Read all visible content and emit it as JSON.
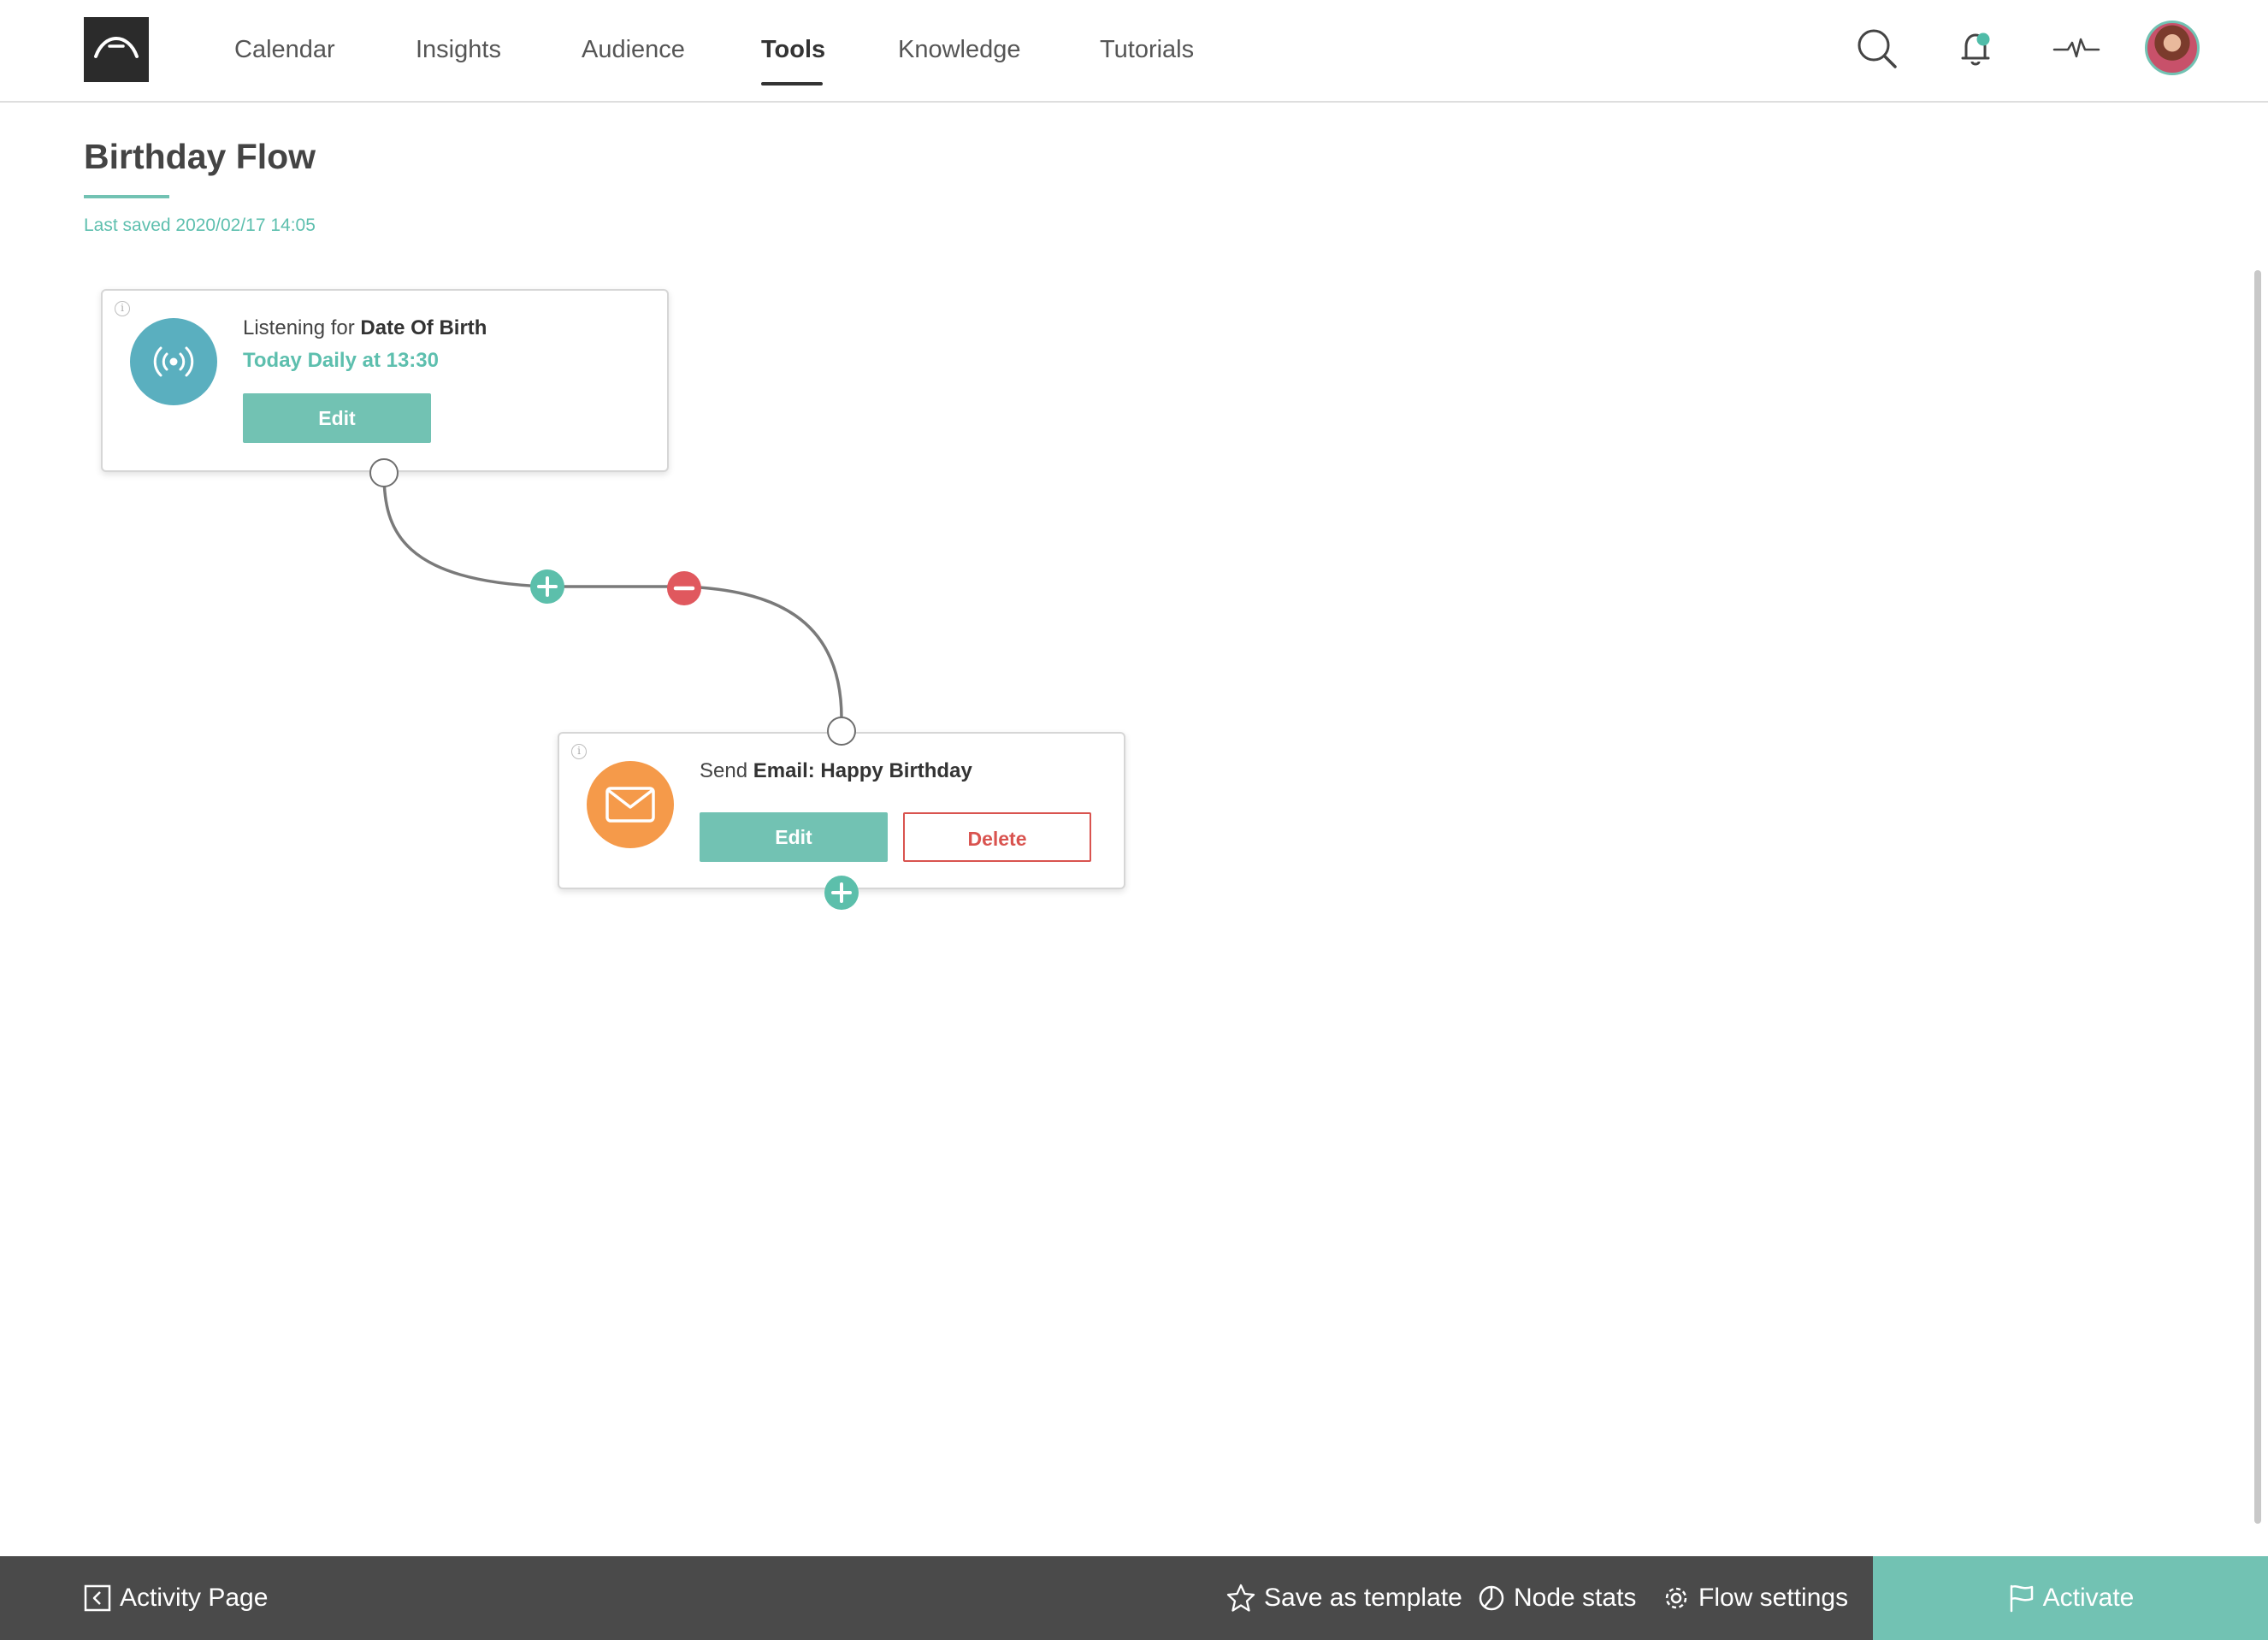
{
  "nav": {
    "items": [
      {
        "label": "Calendar",
        "active": false
      },
      {
        "label": "Insights",
        "active": false
      },
      {
        "label": "Audience",
        "active": false
      },
      {
        "label": "Tools",
        "active": true
      },
      {
        "label": "Knowledge",
        "active": false
      },
      {
        "label": "Tutorials",
        "active": false
      }
    ],
    "icons": [
      "search-icon",
      "bell-icon",
      "activity-pulse-icon",
      "avatar"
    ]
  },
  "page": {
    "title": "Birthday Flow",
    "last_saved": "Last saved 2020/02/17 14:05"
  },
  "flow": {
    "trigger_node": {
      "icon": "broadcast-icon",
      "prefix": "Listening for",
      "field": "Date Of Birth",
      "schedule": "Today Daily at 13:30",
      "edit_label": "Edit"
    },
    "email_node": {
      "icon": "envelope-icon",
      "prefix": "Send",
      "action": "Email: Happy Birthday",
      "edit_label": "Edit",
      "delete_label": "Delete"
    }
  },
  "bottom_bar": {
    "back_label": "Activity Page",
    "save_template_label": "Save as template",
    "node_stats_label": "Node stats",
    "flow_settings_label": "Flow settings",
    "activate_label": "Activate"
  },
  "colors": {
    "accent": "#72c2b3",
    "trigger_icon_bg": "#5aafbf",
    "email_icon_bg": "#f59a4a",
    "delete": "#d9534f",
    "bottom_bar": "#4a4a4a"
  }
}
